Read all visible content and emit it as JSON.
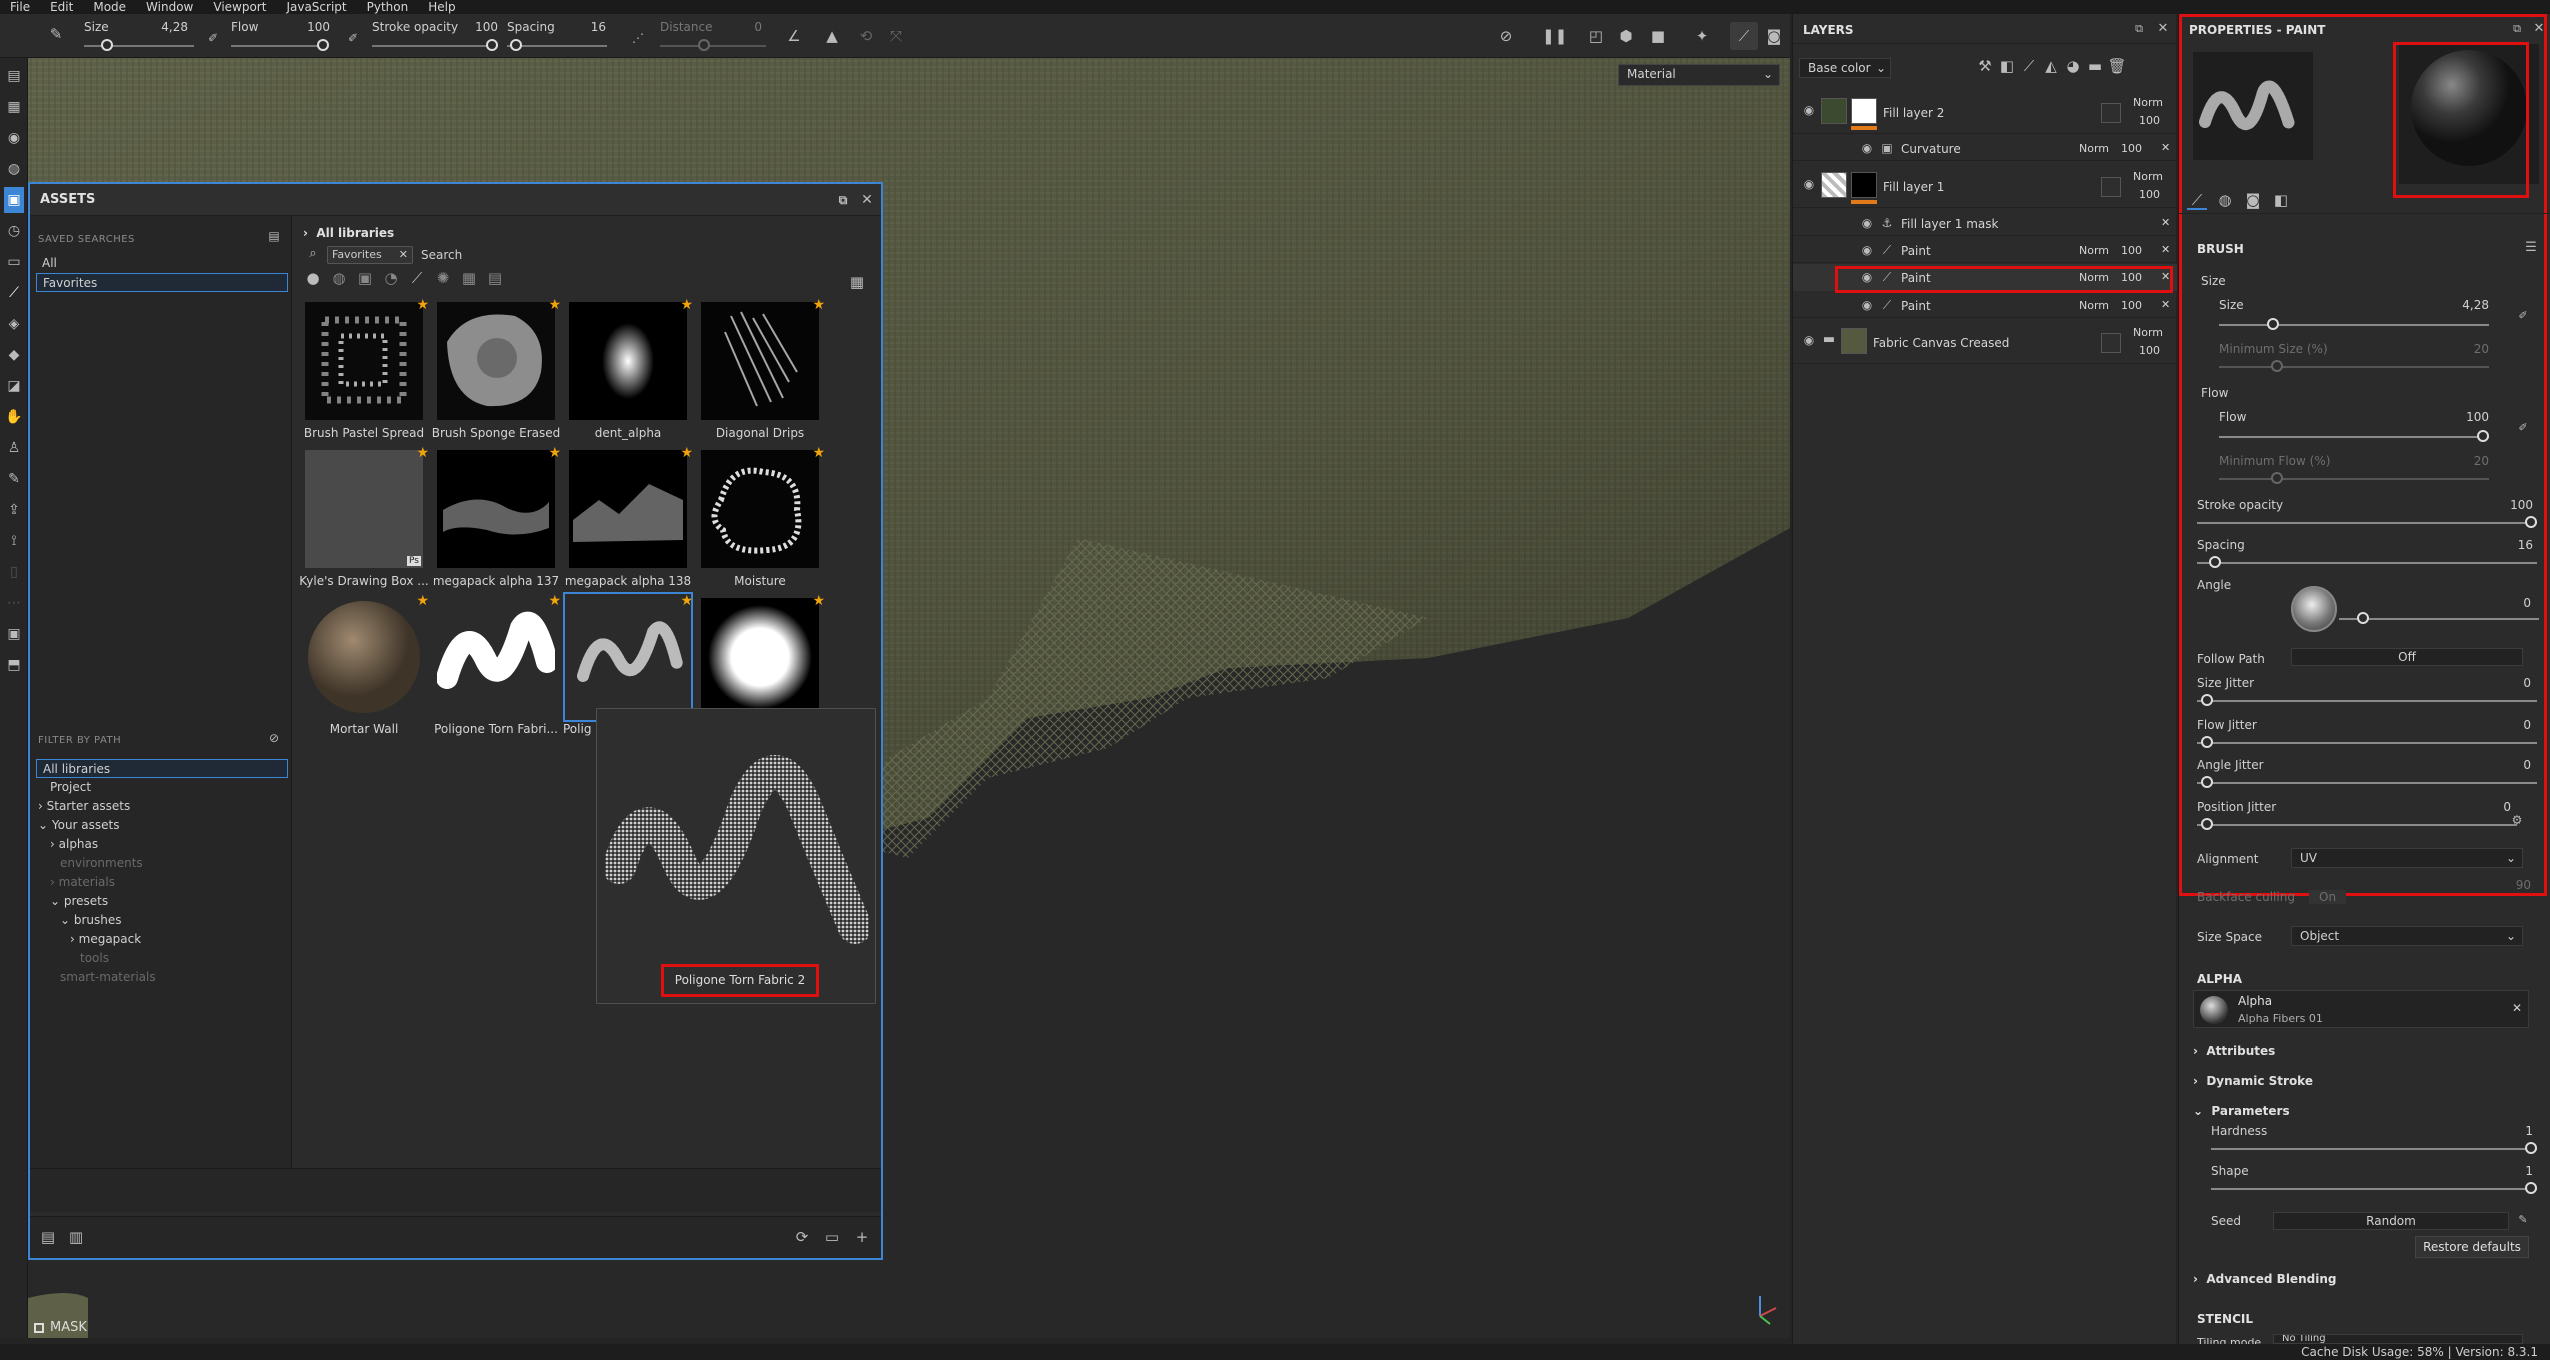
{
  "menu": [
    "File",
    "Edit",
    "Mode",
    "Window",
    "Viewport",
    "JavaScript",
    "Python",
    "Help"
  ],
  "toolbar": {
    "size_label": "Size",
    "size_value": "4,28",
    "flow_label": "Flow",
    "flow_value": "100",
    "stroke_label": "Stroke opacity",
    "stroke_value": "100",
    "spacing_label": "Spacing",
    "spacing_value": "16",
    "distance_label": "Distance",
    "distance_value": "0"
  },
  "viewport": {
    "mode_dropdown": "Material",
    "mask_label": "MASK"
  },
  "assets": {
    "title": "ASSETS",
    "saved_searches_label": "SAVED SEARCHES",
    "saved_searches": [
      "All",
      "Favorites"
    ],
    "breadcrumb": "All libraries",
    "filter_chip": "Favorites",
    "search_placeholder": "Search",
    "filter_by_path_label": "FILTER BY PATH",
    "tree": [
      {
        "label": "All libraries",
        "state": "selected"
      },
      {
        "label": "Project",
        "state": "normal"
      },
      {
        "label": "Starter assets",
        "state": "collapsed"
      },
      {
        "label": "Your assets",
        "state": "expanded"
      },
      {
        "label": "alphas",
        "state": "collapsed"
      },
      {
        "label": "environments",
        "state": "dim"
      },
      {
        "label": "materials",
        "state": "dim-collapsed"
      },
      {
        "label": "presets",
        "state": "expanded"
      },
      {
        "label": "brushes",
        "state": "expanded"
      },
      {
        "label": "megapack",
        "state": "collapsed"
      },
      {
        "label": "tools",
        "state": "dim"
      },
      {
        "label": "smart-materials",
        "state": "dim"
      }
    ],
    "items": [
      "Brush Pastel Spread",
      "Brush Sponge Erased",
      "dent_alpha",
      "Diagonal Drips",
      "Kyle's Drawing Box ...",
      "megapack alpha 137",
      "megapack alpha 138",
      "Moisture",
      "Mortar Wall",
      "Poligone Torn Fabri...",
      "Polig",
      ""
    ],
    "preview_label": "Poligone Torn Fabric 2"
  },
  "layers": {
    "title": "LAYERS",
    "channel": "Base color",
    "rows": [
      {
        "name": "Fill layer 2",
        "blend": "Norm",
        "opacity": "100"
      },
      {
        "name": "Curvature",
        "blend": "Norm",
        "opacity": "100"
      },
      {
        "name": "Fill layer 1",
        "blend": "Norm",
        "opacity": "100"
      },
      {
        "name": "Fill layer 1 mask",
        "blend": "",
        "opacity": ""
      },
      {
        "name": "Paint",
        "blend": "Norm",
        "opacity": "100"
      },
      {
        "name": "Paint",
        "blend": "Norm",
        "opacity": "100"
      },
      {
        "name": "Paint",
        "blend": "Norm",
        "opacity": "100"
      },
      {
        "name": "Fabric Canvas Creased",
        "blend": "Norm",
        "opacity": "100"
      }
    ]
  },
  "properties": {
    "title": "PROPERTIES - PAINT",
    "brush_header": "BRUSH",
    "size_group": "Size",
    "size_label": "Size",
    "size_value": "4,28",
    "min_size_label": "Minimum Size (%)",
    "min_size_value": "20",
    "flow_group": "Flow",
    "flow_label": "Flow",
    "flow_value": "100",
    "min_flow_label": "Minimum Flow (%)",
    "min_flow_value": "20",
    "stroke_label": "Stroke opacity",
    "stroke_value": "100",
    "spacing_label": "Spacing",
    "spacing_value": "16",
    "angle_label": "Angle",
    "angle_value": "0",
    "follow_path_label": "Follow Path",
    "follow_path_value": "Off",
    "size_jitter_label": "Size Jitter",
    "size_jitter_value": "0",
    "flow_jitter_label": "Flow Jitter",
    "flow_jitter_value": "0",
    "angle_jitter_label": "Angle Jitter",
    "angle_jitter_value": "0",
    "position_jitter_label": "Position Jitter",
    "position_jitter_value": "0",
    "alignment_label": "Alignment",
    "alignment_value": "UV",
    "backface_label": "Backface culling",
    "backface_value": "On",
    "backface_num": "90",
    "size_space_label": "Size Space",
    "size_space_value": "Object",
    "alpha_header": "ALPHA",
    "alpha_title": "Alpha",
    "alpha_name": "Alpha Fibers 01",
    "attributes": "Attributes",
    "dynamic_stroke": "Dynamic Stroke",
    "parameters": "Parameters",
    "hardness_label": "Hardness",
    "hardness_value": "1",
    "shape_label": "Shape",
    "shape_value": "1",
    "seed_label": "Seed",
    "seed_value": "Random",
    "restore": "Restore defaults",
    "advanced_blending": "Advanced Blending",
    "stencil_header": "STENCIL",
    "tiling_label": "Tiling mode",
    "tiling_value": "No Tiling"
  },
  "status": {
    "cache": "Cache Disk Usage:   58%  |  Version: 8.3.1"
  }
}
